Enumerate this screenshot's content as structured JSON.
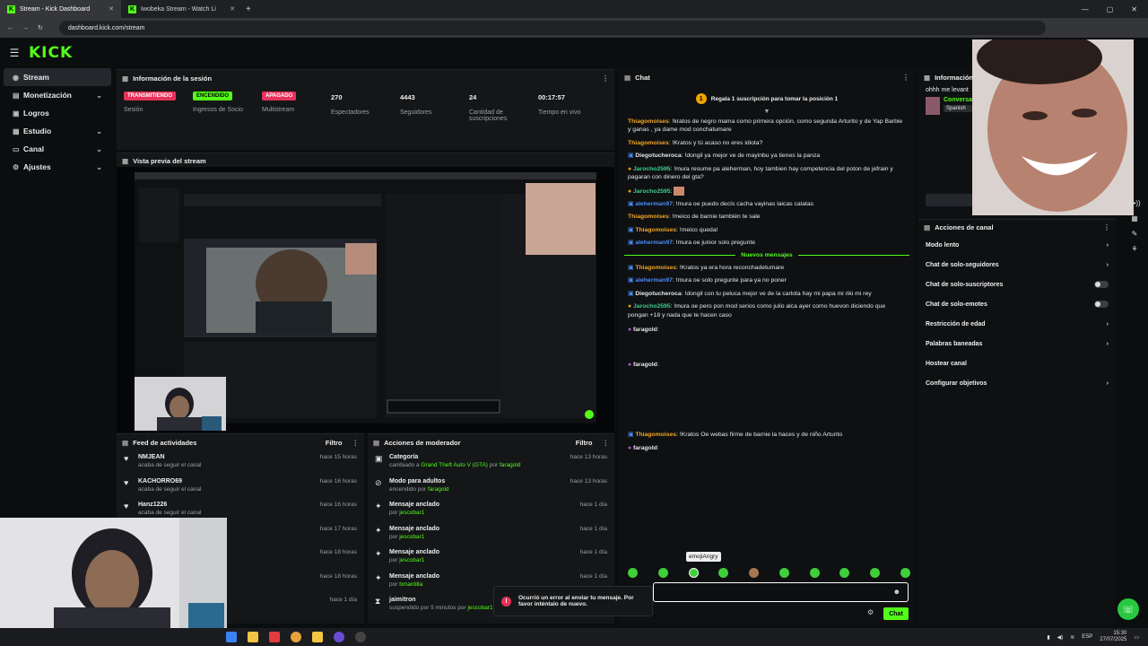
{
  "browser": {
    "tabs": [
      {
        "title": "Stream - Kick Dashboard"
      },
      {
        "title": "Iwobeka Stream - Watch Li"
      }
    ],
    "url": "dashboard.kick.com/stream"
  },
  "app": {
    "logo": "KICK"
  },
  "sidebar": {
    "items": [
      {
        "label": "Stream",
        "icon": "broadcast-icon",
        "active": true
      },
      {
        "label": "Monetización",
        "icon": "money-icon"
      },
      {
        "label": "Logros",
        "icon": "trophy-icon"
      },
      {
        "label": "Estudio",
        "icon": "studio-icon"
      },
      {
        "label": "Canal",
        "icon": "channel-icon"
      },
      {
        "label": "Ajustes",
        "icon": "settings-icon"
      }
    ]
  },
  "session": {
    "title": "Información de la sesión",
    "stats": [
      {
        "badge": "TRANSMITIENDO",
        "badge_color": "#e5325a",
        "label": "Sesión"
      },
      {
        "badge": "ENCENDIDO",
        "badge_color": "#53fc18",
        "label": "Ingresos de Socio"
      },
      {
        "badge": "APAGADO",
        "badge_color": "#e5325a",
        "label": "Multistream"
      },
      {
        "value": "270",
        "label": "Espectadores"
      },
      {
        "value": "4443",
        "label": "Seguidores"
      },
      {
        "value": "24",
        "label": "Cantidad de suscripciones"
      },
      {
        "value": "00:17:57",
        "label": "Tiempo en vivo"
      }
    ]
  },
  "preview": {
    "title": "Vista previa del stream"
  },
  "feed": {
    "title": "Feed de actividades",
    "filter": "Filtro",
    "items": [
      {
        "name": "NMJEAN",
        "sub": "acaba de seguir el canal",
        "time": "hace 15 horas"
      },
      {
        "name": "KACHORRO69",
        "sub": "acaba de seguir el canal",
        "time": "hace 16 horas"
      },
      {
        "name": "Hanz1226",
        "sub": "acaba de seguir el canal",
        "time": "hace 16 horas"
      },
      {
        "name": "",
        "sub": "",
        "time": "hace 17 horas"
      },
      {
        "name": "",
        "sub": "",
        "time": "hace 18 horas"
      },
      {
        "name": "",
        "sub": "",
        "time": "hace 18 horas"
      },
      {
        "name": "",
        "sub": "",
        "time": "hace 1 día"
      }
    ]
  },
  "mod": {
    "title": "Acciones de moderador",
    "filter": "Filtro",
    "items": [
      {
        "name": "Categoría",
        "pre": "cambiado a ",
        "hl": "Grand Theft Auto V (GTA)",
        "by": " por ",
        "user": "faragold",
        "time": "hace 13 horas",
        "icon": "category-icon"
      },
      {
        "name": "Modo para adultos",
        "pre": "encendido por ",
        "hl": "",
        "by": "",
        "user": "faragold",
        "time": "hace 13 horas",
        "icon": "adult-icon"
      },
      {
        "name": "Mensaje anclado",
        "pre": "por ",
        "hl": "",
        "by": "",
        "user": "jescobar1",
        "time": "hace 1 día",
        "icon": "pin-icon"
      },
      {
        "name": "Mensaje anclado",
        "pre": "por ",
        "hl": "",
        "by": "",
        "user": "jescobar1",
        "time": "hace 1 día",
        "icon": "pin-icon"
      },
      {
        "name": "Mensaje anclado",
        "pre": "por ",
        "hl": "",
        "by": "",
        "user": "jescobar1",
        "time": "hace 1 día",
        "icon": "pin-icon"
      },
      {
        "name": "Mensaje anclado",
        "pre": "por ",
        "hl": "",
        "by": "",
        "user": "bmantilla",
        "time": "hace 1 día",
        "icon": "pin-icon"
      },
      {
        "name": "jaimitron",
        "pre": "suspendido por 5 minutos por ",
        "hl": "",
        "by": "",
        "user": "jescobar1",
        "time": "",
        "icon": "timeout-icon"
      }
    ]
  },
  "chat": {
    "title": "Chat",
    "pinned_rank": "1",
    "pinned": "Regala 1 suscripción para tomar la posición 1",
    "messages": [
      {
        "user": "Thiagomoises",
        "color": "#f5a623",
        "text": ": !kratos de negro mama como primera opción, como segunda Arturito y de Yap Barbie y ganas , ya dame mod conchatumare"
      },
      {
        "user": "Thiagomoises",
        "color": "#f5a623",
        "text": ": !Kratos y tú acaso no eres idiota?"
      },
      {
        "user": "Diegotucheroca",
        "color": "#e6e8ea",
        "text": ": !dongil ya mejor ve de mayinbu ya tienes la panza"
      },
      {
        "user": "Jarocho2595",
        "color": "#3ecf8e",
        "text": ": !mura resume pa aleherman, hoy tambien hay competencia del poton de jefrain y pagaran con dinero del gta?"
      },
      {
        "user": "Jarocho2595",
        "color": "#3ecf8e",
        "text": ":"
      },
      {
        "user": "aleherman97",
        "color": "#4a8df6",
        "text": ": !mura oe puedo decís cacha vayinas laicas calatas"
      },
      {
        "user": "Thiagomoises",
        "color": "#f5a623",
        "text": ": !meico de barnie también te sale"
      },
      {
        "user": "Thiagomoises",
        "color": "#f5a623",
        "text": ": !meico queda!"
      },
      {
        "user": "aleherman97",
        "color": "#4a8df6",
        "text": ": !mura oe junior solo pregunte"
      }
    ],
    "new_label": "Nuevos mensajes",
    "new_messages": [
      {
        "user": "Thiagomoises",
        "color": "#f5a623",
        "text": ": !Kratos ya era hora reconchadetumare"
      },
      {
        "user": "aleherman97",
        "color": "#4a8df6",
        "text": ": !mura oe solo pregunte para ya no poner"
      },
      {
        "user": "Diegotucheroca",
        "color": "#e6e8ea",
        "text": ": !dongil con tu peluca mejor ve de la carlota hay mi papa mi riki mi rey"
      },
      {
        "user": "Jarocho2595",
        "color": "#3ecf8e",
        "text": ": !mura oe pero pon mod serios como julio alca ayer como huevon diciendo que pongan +18 y nada que te hacen caso"
      },
      {
        "user": "faragold",
        "color": "#e6e8ea",
        "text": ":"
      },
      {
        "user": "faragold",
        "color": "#e6e8ea",
        "text": ":"
      }
    ],
    "late_messages": [
      {
        "user": "Thiagomoises",
        "color": "#f5a623",
        "text": ": !Kratos Oe webas firme de barnie la haces y de niño Arturito"
      },
      {
        "user": "faragold",
        "color": "#e6e8ea",
        "text": ":"
      }
    ],
    "tooltip": "emojiAngry",
    "send_label": "Chat",
    "error": "Ocurrió un error al enviar tu mensaje. Por favor inténtalo de nuevo."
  },
  "info": {
    "title": "Información",
    "snippet": "ohhh me levant",
    "category_link": "Conversa",
    "tag": "Spanish",
    "edit_label": "Editar"
  },
  "channel_actions": {
    "title": "Acciones de canal",
    "items": [
      {
        "label": "Modo lento",
        "control": "arrow"
      },
      {
        "label": "Chat de solo-seguidores",
        "control": "arrow"
      },
      {
        "label": "Chat de solo-suscriptores",
        "control": "toggle"
      },
      {
        "label": "Chat de solo-emotes",
        "control": "toggle"
      },
      {
        "label": "Restricción de edad",
        "control": "arrow"
      },
      {
        "label": "Palabras baneadas",
        "control": "arrow"
      },
      {
        "label": "Hostear canal",
        "control": "none"
      },
      {
        "label": "Configurar objetivos",
        "control": "arrow"
      }
    ]
  },
  "taskbar": {
    "lang": "ESP",
    "time": "15:30",
    "date": "27/07/2025"
  },
  "colors": {
    "accent": "#53fc18",
    "live": "#e5325a"
  }
}
